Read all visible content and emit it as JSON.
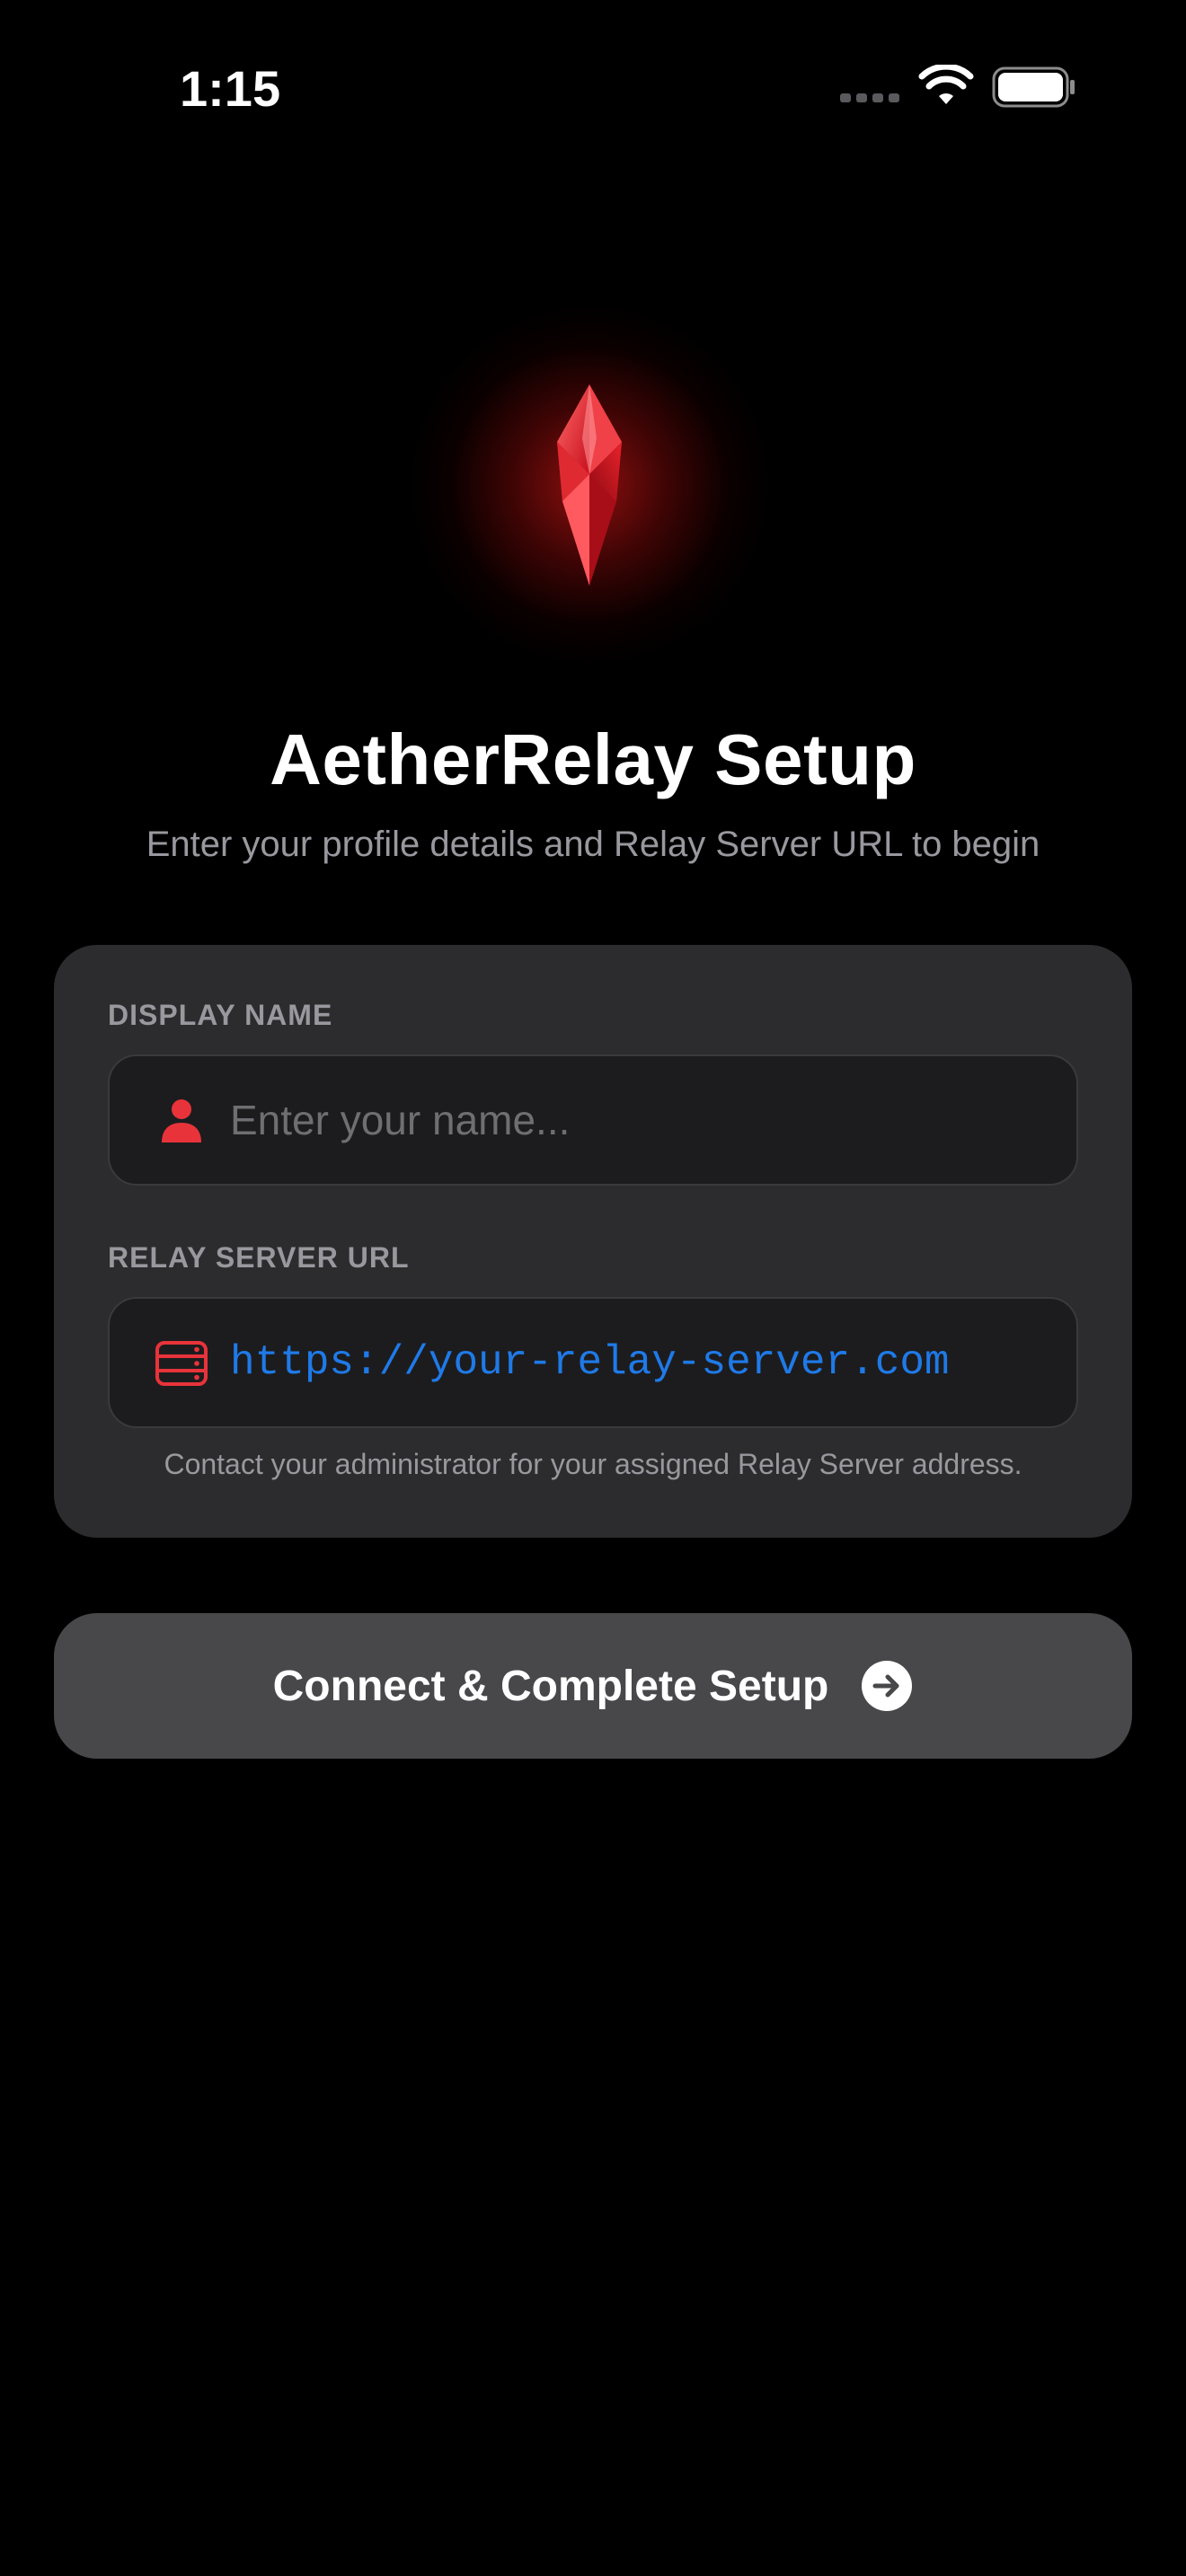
{
  "status_bar": {
    "time": "1:15",
    "icons": [
      "signal-dots-icon",
      "wifi-icon",
      "battery-icon"
    ]
  },
  "logo": {
    "icon": "red-crystal-icon",
    "accent_color": "#e8333a"
  },
  "header": {
    "title": "AetherRelay Setup",
    "subtitle": "Enter your profile details and Relay Server URL to begin"
  },
  "form": {
    "display_name": {
      "label": "DISPLAY NAME",
      "placeholder": "Enter your name...",
      "value": "",
      "icon": "person-icon"
    },
    "relay_server": {
      "label": "RELAY SERVER URL",
      "value": "https://your-relay-server.com",
      "icon": "server-icon"
    },
    "helper_text": "Contact your administrator for your assigned Relay Server address."
  },
  "actions": {
    "connect_label": "Connect & Complete Setup",
    "connect_icon": "arrow-right-circle-icon"
  },
  "colors": {
    "background": "#000000",
    "card": "#2c2c2e",
    "field": "#1c1c1e",
    "button": "#48484a",
    "accent_red": "#e8333a",
    "link_blue": "#1f7ae8",
    "secondary_text": "#98989e"
  }
}
